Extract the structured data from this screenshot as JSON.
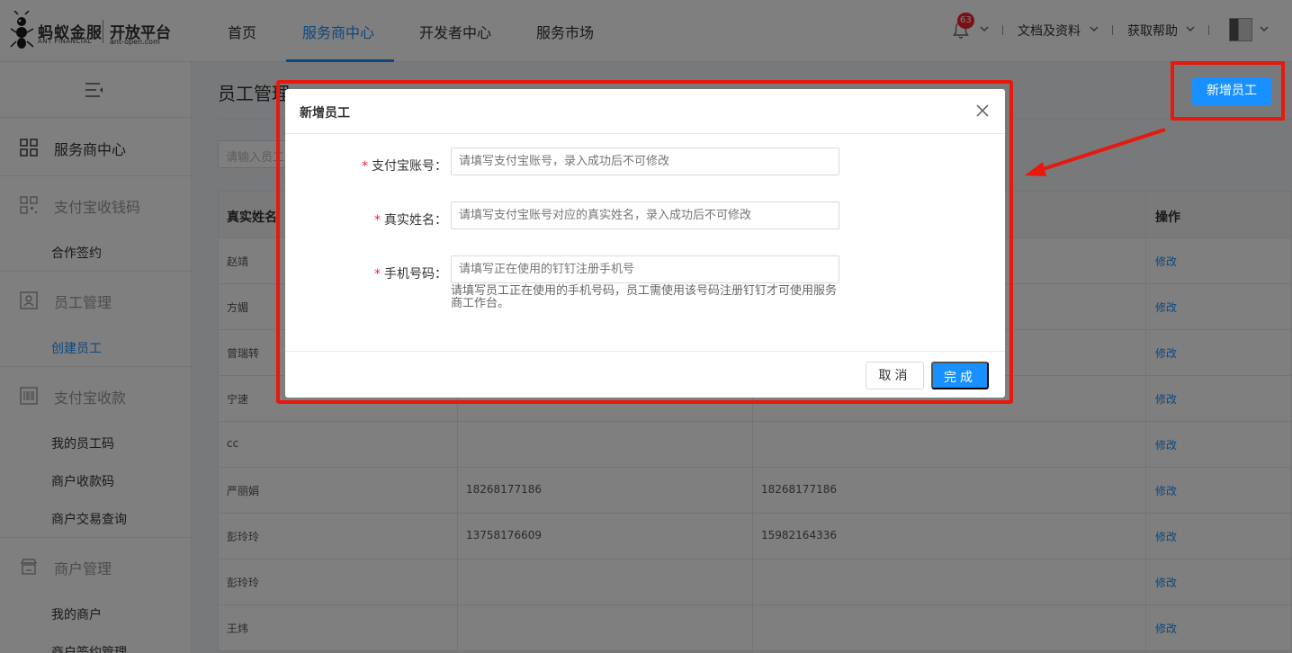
{
  "logo": {
    "brand_cn": "蚂蚁金服",
    "brand_en": "ANT FINANCIAL",
    "platform_cn": "开放平台",
    "platform_en": "ant-open.com"
  },
  "nav": {
    "items": [
      "首页",
      "服务商中心",
      "开发者中心",
      "服务市场"
    ],
    "active_index": 1
  },
  "tools": {
    "notification_count": "63",
    "docs": "文档及资料",
    "help": "获取帮助"
  },
  "sidebar": {
    "groups": [
      {
        "label": "服务商中心",
        "icon": "grid-icon",
        "items": []
      },
      {
        "label": "支付宝收钱码",
        "icon": "qrcode-icon",
        "items": [
          "合作签约"
        ]
      },
      {
        "label": "员工管理",
        "icon": "staff-icon",
        "items": [
          "创建员工"
        ]
      },
      {
        "label": "支付宝收款",
        "icon": "barcode-icon",
        "items": [
          "我的员工码",
          "商户收款码",
          "商户交易查询"
        ]
      },
      {
        "label": "商户管理",
        "icon": "shop-icon",
        "items": [
          "我的商户",
          "商户签约管理"
        ]
      }
    ],
    "active_item": "创建员工"
  },
  "main": {
    "title": "员工管理",
    "add_button": "新增员工",
    "search_placeholder": "请输入员工",
    "table": {
      "headers": [
        "真实姓名",
        "",
        "",
        "操作"
      ],
      "rows": [
        {
          "name": "赵靖",
          "col2": "",
          "col3": "",
          "action": "修改"
        },
        {
          "name": "方媚",
          "col2": "",
          "col3": "",
          "action": "修改"
        },
        {
          "name": "曾瑞转",
          "col2": "",
          "col3": "",
          "action": "修改"
        },
        {
          "name": "宁速",
          "col2": "",
          "col3": "",
          "action": "修改"
        },
        {
          "name": "cc",
          "col2": "",
          "col3": "",
          "action": "修改"
        },
        {
          "name": "严丽娟",
          "col2": "18268177186",
          "col3": "18268177186",
          "action": "修改"
        },
        {
          "name": "彭玲玲",
          "col2": "13758176609",
          "col3": "15982164336",
          "action": "修改"
        },
        {
          "name": "彭玲玲",
          "col2": "",
          "col3": "",
          "action": "修改"
        },
        {
          "name": "王炜",
          "col2": "",
          "col3": "",
          "action": "修改"
        }
      ]
    }
  },
  "modal": {
    "title": "新增员工",
    "fields": [
      {
        "label": "支付宝账号：",
        "required": "*",
        "placeholder": "请填写支付宝账号，录入成功后不可修改"
      },
      {
        "label": "真实姓名：",
        "required": "*",
        "placeholder": "请填写支付宝账号对应的真实姓名，录入成功后不可修改"
      },
      {
        "label": "手机号码：",
        "required": "*",
        "placeholder": "请填写正在使用的钉钉注册手机号"
      }
    ],
    "phone_help": "请填写员工正在使用的手机号码，员工需使用该号码注册钉钉才可使用服务商工作台。",
    "cancel": "取消",
    "ok": "完成"
  },
  "colors": {
    "primary": "#1890ff",
    "annotation": "#e8180c",
    "required": "#f5222d"
  }
}
